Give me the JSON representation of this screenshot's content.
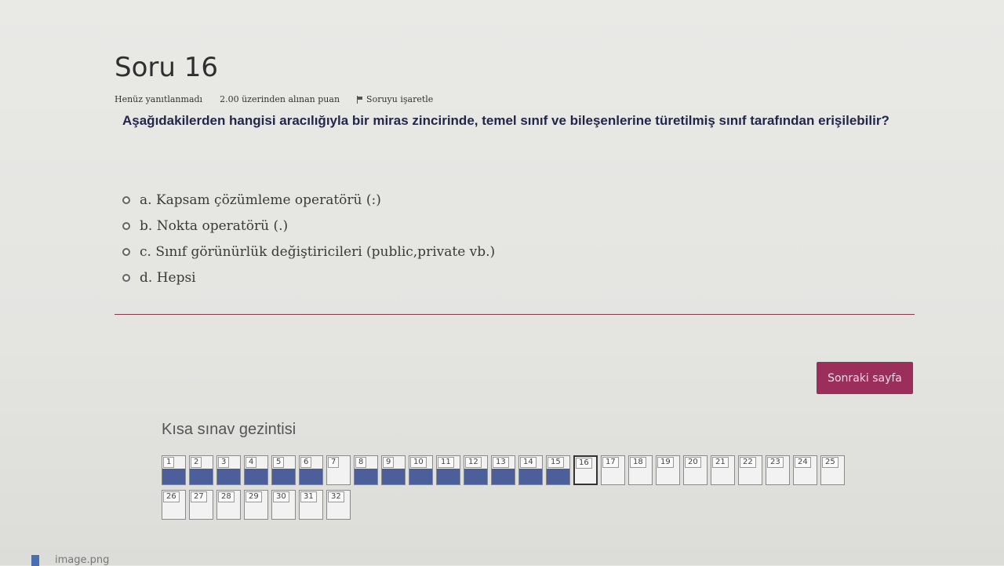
{
  "question": {
    "title": "Soru 16",
    "status": "Henüz yanıtlanmadı",
    "score": "2.00 üzerinden alınan puan",
    "flag_label": "Soruyu işaretle",
    "text": "Aşağıdakilerden hangisi aracılığıyla bir miras zincirinde, temel sınıf ve bileşenlerine türetilmiş sınıf tarafından erişilebilir?",
    "answers": [
      {
        "label": "a. Kapsam çözümleme operatörü (:)"
      },
      {
        "label": "b. Nokta operatörü (.)"
      },
      {
        "label": "c. Sınıf görünürlük değiştiricileri (public,private vb.)"
      },
      {
        "label": "d. Hepsi"
      }
    ]
  },
  "actions": {
    "next_label": "Sonraki sayfa"
  },
  "navigation": {
    "title": "Kısa sınav gezintisi",
    "current": 16,
    "items": [
      {
        "n": "1",
        "answered": true
      },
      {
        "n": "2",
        "answered": true
      },
      {
        "n": "3",
        "answered": true
      },
      {
        "n": "4",
        "answered": true
      },
      {
        "n": "5",
        "answered": true
      },
      {
        "n": "6",
        "answered": true
      },
      {
        "n": "7",
        "answered": false
      },
      {
        "n": "8",
        "answered": true
      },
      {
        "n": "9",
        "answered": true
      },
      {
        "n": "10",
        "answered": true
      },
      {
        "n": "11",
        "answered": true
      },
      {
        "n": "12",
        "answered": true
      },
      {
        "n": "13",
        "answered": true
      },
      {
        "n": "14",
        "answered": true
      },
      {
        "n": "15",
        "answered": true
      },
      {
        "n": "16",
        "answered": false
      },
      {
        "n": "17",
        "answered": false
      },
      {
        "n": "18",
        "answered": false
      },
      {
        "n": "19",
        "answered": false
      },
      {
        "n": "20",
        "answered": false
      },
      {
        "n": "21",
        "answered": false
      },
      {
        "n": "22",
        "answered": false
      },
      {
        "n": "23",
        "answered": false
      },
      {
        "n": "24",
        "answered": false
      },
      {
        "n": "25",
        "answered": false
      },
      {
        "n": "26",
        "answered": false
      },
      {
        "n": "27",
        "answered": false
      },
      {
        "n": "28",
        "answered": false
      },
      {
        "n": "29",
        "answered": false
      },
      {
        "n": "30",
        "answered": false
      },
      {
        "n": "31",
        "answered": false
      },
      {
        "n": "32",
        "answered": false
      }
    ]
  },
  "downloads": {
    "file_label": "image.png"
  },
  "colors": {
    "accent": "#9c2e5b",
    "answered": "#4d5f9a"
  }
}
